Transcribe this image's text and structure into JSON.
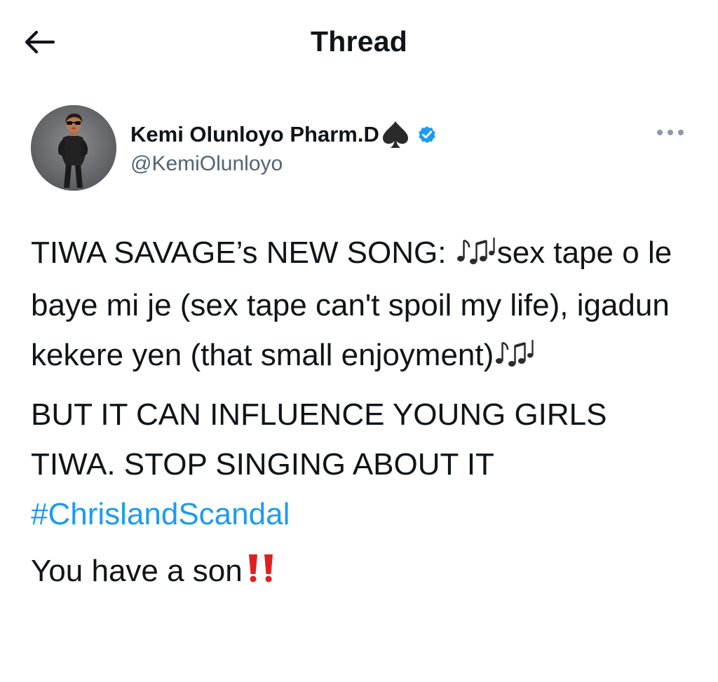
{
  "header": {
    "title": "Thread",
    "back_icon": "arrow-left-icon"
  },
  "author": {
    "display_name": "Kemi Olunloyo Pharm.D",
    "handle": "@KemiOlunloyo",
    "avatar_icon": "avatar-illustration",
    "name_emoji": "spade-suit-icon",
    "verified_icon": "verified-badge-icon",
    "more_icon": "more-options-icon"
  },
  "tweet": {
    "p1_text": "TIWA SAVAGE’s NEW SONG: ",
    "p1_emoji_a": "musical-notes-icon",
    "p1_text_b": "sex tape o le baye mi je (sex tape can't spoil my life), igadun kekere yen (that small enjoyment)",
    "p1_emoji_b": "musical-notes-icon",
    "p2_text": "BUT IT CAN INFLUENCE YOUNG GIRLS TIWA. STOP SINGING ABOUT IT",
    "hashtag": "#ChrislandScandal",
    "p3_text": "You have a son",
    "p3_emoji": "double-exclamation-icon"
  },
  "colors": {
    "text": "#0f1419",
    "secondary": "#536471",
    "link": "#1d9bf0",
    "verified": "#1d9bf0",
    "exclamation": "#e0201f"
  }
}
